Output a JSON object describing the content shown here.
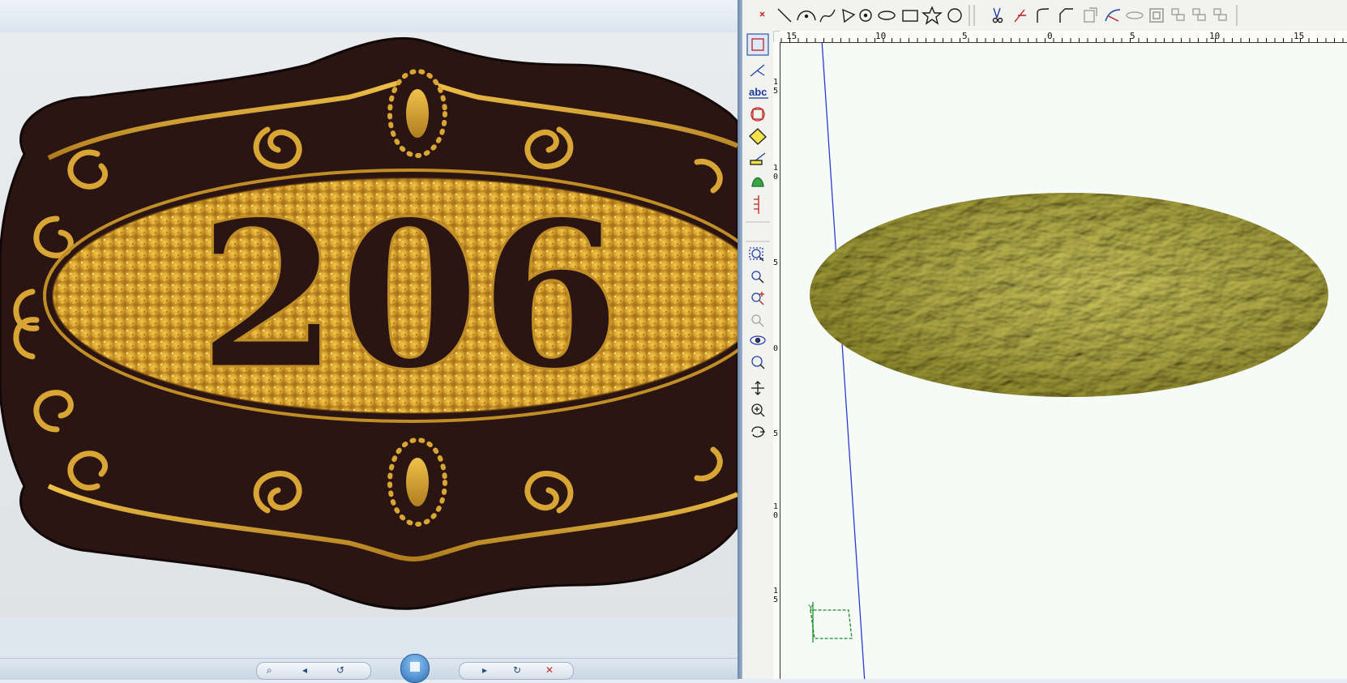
{
  "photo": {
    "plaque_number": "206",
    "colors": {
      "background": "#e3e6e8",
      "plaque": "#2b1512",
      "gold": "#c9952a",
      "gold_light": "#f2c54a"
    }
  },
  "viewer": {
    "icons": [
      "zoom-icon",
      "previous-icon",
      "slideshow-icon",
      "next-icon",
      "rotate-left-icon",
      "rotate-right-icon",
      "delete-icon"
    ]
  },
  "cad": {
    "toolbar_icons": [
      "close-icon",
      "line-icon",
      "arc-icon",
      "curve-icon",
      "polyline-icon",
      "point-icon",
      "ellipse-icon",
      "rectangle-icon",
      "star-icon",
      "circle-icon",
      "trim-icon",
      "extend-icon",
      "fillet-icon",
      "chamfer-icon",
      "offset-icon",
      "bevel-icon",
      "oval-icon",
      "array-icon",
      "group-icon",
      "ungroup-icon",
      "combine-icon"
    ],
    "left_icons": [
      "select-icon",
      "node-edit-icon",
      "text-icon",
      "transform-icon",
      "fill-icon",
      "paint-icon",
      "relief-icon",
      "measure-icon",
      "zoom-window-icon",
      "zoom-out-icon",
      "zoom-in-icon",
      "zoom-prev-icon",
      "view-icon",
      "zoom-fit-icon",
      "pan-icon",
      "zoom-realtime-icon",
      "rotate-view-icon"
    ],
    "ruler_top_labels": [
      "15",
      "10",
      "5",
      "0",
      "5",
      "10",
      "15"
    ],
    "ruler_left_labels": [
      "1\n5",
      "1\n0",
      "5",
      "0",
      "5",
      "1\n0",
      "1\n5"
    ],
    "axis_label": "Y",
    "colors": {
      "relief": "#b9b86a",
      "relief_light": "#e4e29a",
      "relief_dark": "#7d7a33",
      "axis_line": "#2b3bd1",
      "canvas": "#f6fbf7"
    }
  }
}
